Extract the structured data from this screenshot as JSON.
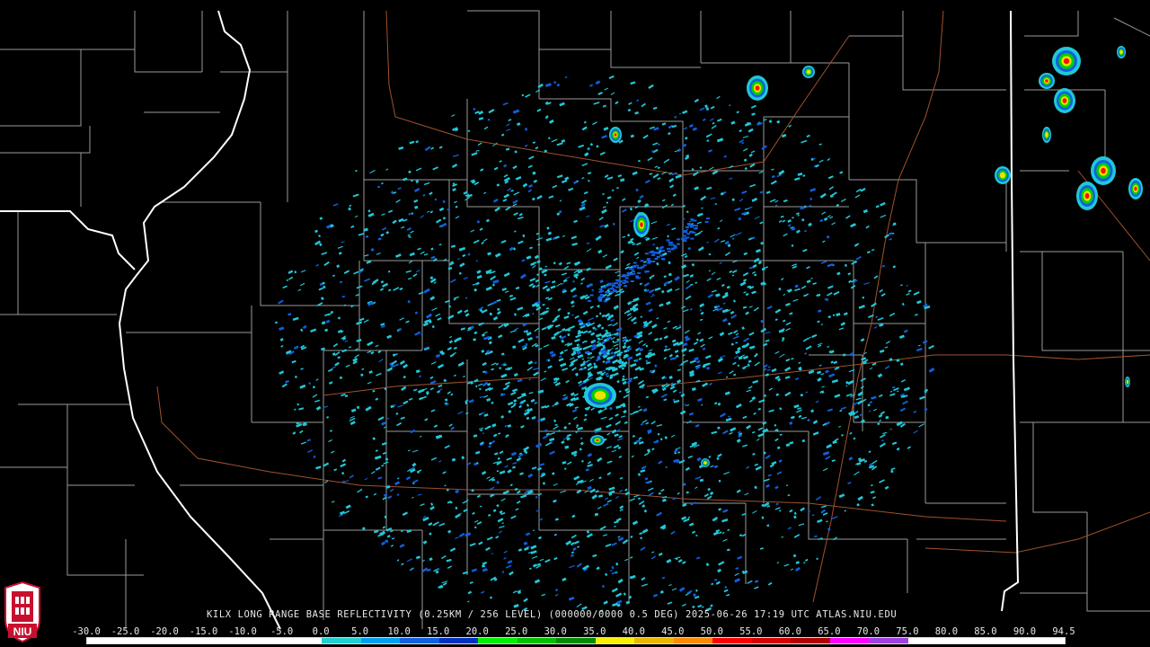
{
  "product": {
    "caption": "KILX LONG RANGE BASE REFLECTIVITY (0.25KM / 256 LEVEL) (000000/0000 0.5 DEG) 2025-06-26 17:19 UTC  ATLAS.NIU.EDU"
  },
  "colorbar": {
    "labels": [
      "-30.0",
      "-25.0",
      "-20.0",
      "-15.0",
      "-10.0",
      "-5.0",
      "0.0",
      "5.0",
      "10.0",
      "15.0",
      "20.0",
      "25.0",
      "30.0",
      "35.0",
      "40.0",
      "45.0",
      "50.0",
      "55.0",
      "60.0",
      "65.0",
      "70.0",
      "75.0",
      "80.0",
      "85.0",
      "90.0",
      "94.5"
    ],
    "colors": [
      "#ffffff",
      "#ffffff",
      "#ffffff",
      "#ffffff",
      "#ffffff",
      "#ffffff",
      "#20d0d0",
      "#00a0f0",
      "#1060e0",
      "#0030c0",
      "#00f000",
      "#00c000",
      "#008c00",
      "#f8f000",
      "#e8b800",
      "#ff8a00",
      "#ff0000",
      "#d80000",
      "#b00000",
      "#ff00ff",
      "#a040e0",
      "#ffffff",
      "#ffffff",
      "#ffffff",
      "#ffffff"
    ]
  },
  "logo": {
    "text": "NIU",
    "colors": {
      "primary": "#c8102e",
      "secondary": "#ffffff"
    }
  },
  "map": {
    "colors": {
      "background": "#000000",
      "state_border": "#ffffff",
      "county_border": "#9a9a9a",
      "highway": "#a0522d",
      "echo_low": "#20c8d8",
      "echo_mid": "#1060e0",
      "echo_green": "#00d000",
      "echo_yellow": "#f0e000",
      "echo_red": "#ff1000"
    }
  }
}
